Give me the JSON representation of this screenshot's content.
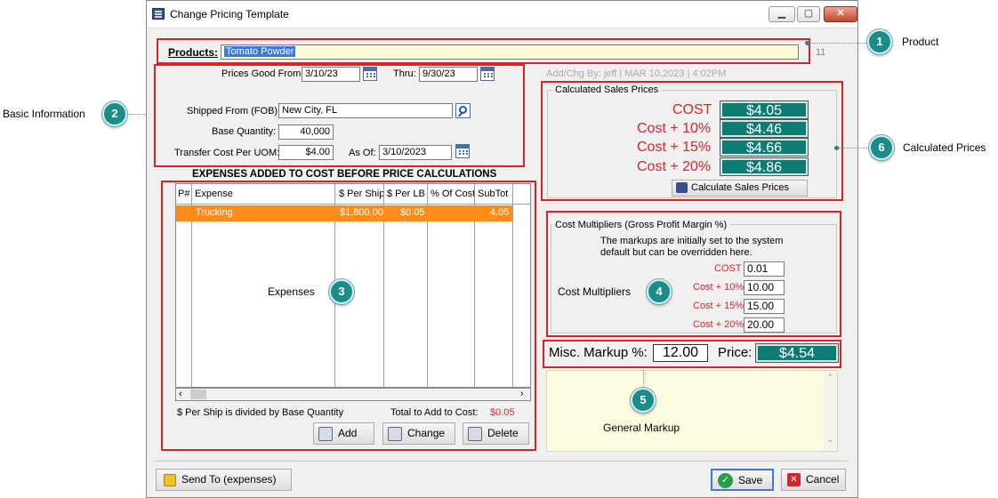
{
  "window": {
    "title": "Change Pricing Template"
  },
  "product": {
    "label": "Products:",
    "value": "Tomato Powder",
    "count": "11"
  },
  "basic": {
    "prices_good_from_label": "Prices Good From:",
    "prices_good_from": "3/10/23",
    "thru_label": "Thru:",
    "thru": "9/30/23",
    "shipped_from_label": "Shipped From (FOB):",
    "shipped_from": "New City, FL",
    "base_qty_label": "Base Quantity:",
    "base_qty": "40,000",
    "transfer_cost_label": "Transfer Cost Per UOM:",
    "transfer_cost": "$4.00",
    "as_of_label": "As Of:",
    "as_of": "3/10/2023"
  },
  "addchg": "Add/Chg By: jeff | MAR 10,2023 | 4:02PM",
  "expenses": {
    "heading": "EXPENSES ADDED TO COST BEFORE PRICE CALCULATIONS",
    "columns": [
      "P#",
      "Expense",
      "$ Per Ship",
      "$ Per LB",
      "% Of Cost",
      "SubTot"
    ],
    "rows": [
      {
        "p": "",
        "expense": "Trucking",
        "per_ship": "$1,800.00",
        "per_lb": "$0.05",
        "pct": "",
        "subtot": "4.05"
      }
    ],
    "note": "$ Per Ship is divided by Base Quantity",
    "total_label": "Total to Add to Cost:",
    "total": "$0.05",
    "add": "Add",
    "change": "Change",
    "delete": "Delete"
  },
  "calc": {
    "title": "Calculated Sales Prices",
    "rows": [
      {
        "label": "COST",
        "value": "$4.05"
      },
      {
        "label": "Cost + 10%",
        "value": "$4.46"
      },
      {
        "label": "Cost + 15%",
        "value": "$4.66"
      },
      {
        "label": "Cost + 20%",
        "value": "$4.86"
      }
    ],
    "button": "Calculate Sales Prices"
  },
  "mult": {
    "title": "Cost Multipliers (Gross Profit Margin %)",
    "note1": "The markups are initially set to the system",
    "note2": "default but can be overridden here.",
    "rows": [
      {
        "label": "COST",
        "value": "0.01"
      },
      {
        "label": "Cost + 10%",
        "value": "10.00"
      },
      {
        "label": "Cost + 15%",
        "value": "15.00"
      },
      {
        "label": "Cost + 20%",
        "value": "20.00"
      }
    ]
  },
  "misc": {
    "label": "Misc. Markup %:",
    "value": "12.00",
    "price_label": "Price:",
    "price": "$4.54"
  },
  "footer": {
    "send_to": "Send To (expenses)",
    "save": "Save",
    "cancel": "Cancel"
  },
  "callouts": [
    {
      "n": "1",
      "label": "Product"
    },
    {
      "n": "2",
      "label": "Basic Information"
    },
    {
      "n": "3",
      "label": "Expenses"
    },
    {
      "n": "4",
      "label": "Cost Multipliers"
    },
    {
      "n": "5",
      "label": "General Markup"
    },
    {
      "n": "6",
      "label": "Calculated Prices"
    }
  ],
  "colors": {
    "accent_red": "#d9252a",
    "teal": "#1b8c87",
    "price_green": "#0f7c74",
    "row_orange": "#ff8c1a"
  }
}
